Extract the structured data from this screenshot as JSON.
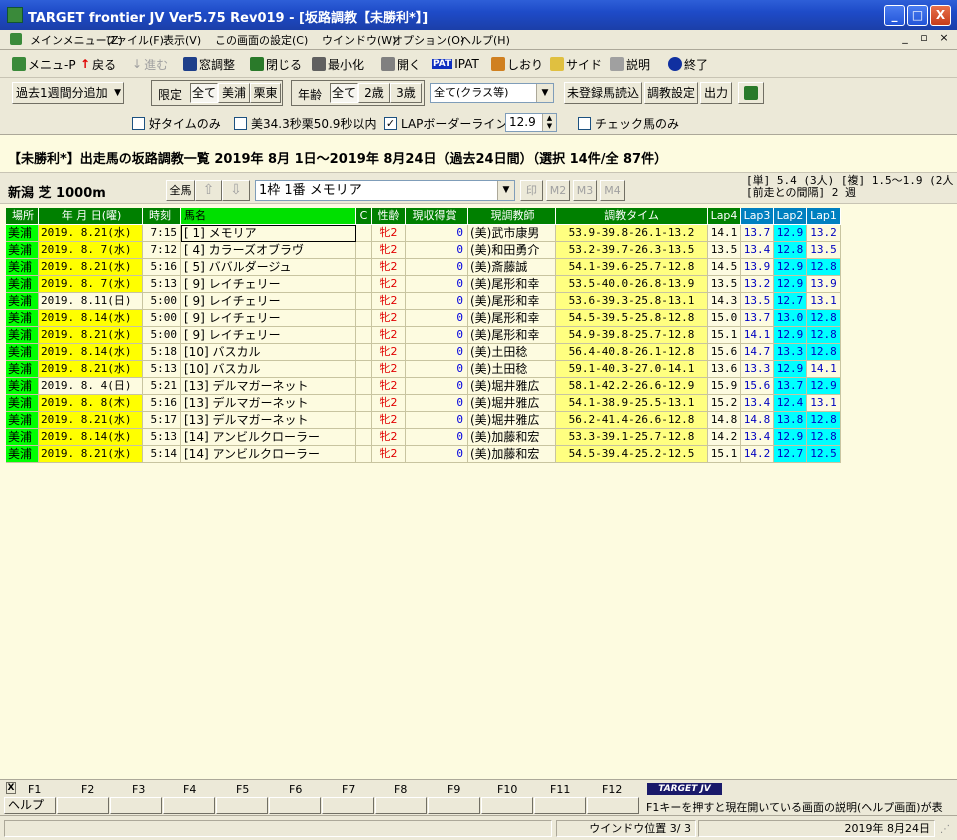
{
  "window": {
    "title": "TARGET frontier JV  Ver5.75  Rev019 - [坂路調教【未勝利*】]",
    "min": "_",
    "max": "□",
    "close": "X"
  },
  "menu": {
    "items": [
      "メインメニュー(Z)",
      "ファイル(F)",
      "表示(V)",
      "この画面の設定(C)",
      "ウインドウ(W)",
      "オプション(O)",
      "ヘルプ(H)"
    ],
    "mdi": [
      "_",
      "▫",
      "×"
    ]
  },
  "toolbar": {
    "items": [
      "メニュ-P",
      "戻る",
      "進む",
      "窓調整",
      "閉じる",
      "最小化",
      "開く",
      "IPAT",
      "しおり",
      "サイド",
      "説明",
      "終了"
    ],
    "pat_badge": "PAT"
  },
  "controls": {
    "period_btn": "過去1週間分追加",
    "period_arrow": "▼",
    "limit_label": "限定",
    "limit_opts": [
      "全て",
      "美浦",
      "栗東"
    ],
    "age_label": "年齢",
    "age_opts": [
      "全て",
      "2歳",
      "3歳"
    ],
    "class_select": "全て(クラス等)",
    "btn_unreg": "未登録馬読込",
    "btn_setting": "調教設定",
    "btn_output": "出力"
  },
  "checks": {
    "good_time": "好タイムのみ",
    "mi_cond": "美34.3秒栗50.9秒以内",
    "lap_border": "LAPボーダーライン",
    "lap_value": "12.9",
    "check_only": "チェック馬のみ",
    "checked_mark": "✓"
  },
  "heading": "【未勝利*】出走馬の坂路調教一覧  2019年 8月 1日～2019年 8月24日（過去24日間）（選択 14件/全 87件）",
  "race": {
    "name": "新潟 芝 1000m",
    "all_horses": "全馬",
    "up": "⇧",
    "down": "⇩",
    "horse_select": "1枠  1番  メモリア",
    "btn_mark": "印",
    "btn_m2": "M2",
    "btn_m3": "M3",
    "btn_m4": "M4",
    "odds_line1": "[単]   5.4 (3人) [複] 1.5～1.9 (2人",
    "odds_line2": "[前走との間隔] 2 週"
  },
  "table": {
    "headers": [
      "場所",
      "年  月 日(曜)",
      "時刻",
      "馬名",
      "C",
      "性齢",
      "現収得賞",
      "現調教師",
      "調教タイム",
      "Lap4",
      "Lap3",
      "Lap2",
      "Lap1"
    ],
    "rows": [
      {
        "place": "美浦",
        "date": "2019. 8.21(水)",
        "time": "7:15",
        "horse": "[ 1]  メモリア",
        "sex": "牝2",
        "prize": "0",
        "trainer": "(美)武市康男",
        "train": "53.9-39.8-26.1-13.2",
        "l4": "14.1",
        "l3": "13.7",
        "l2": "12.9",
        "l1": "13.2",
        "yel": true,
        "hl1": false
      },
      {
        "place": "美浦",
        "date": "2019. 8. 7(水)",
        "time": "7:12",
        "horse": "[ 4]  カラーズオブラヴ",
        "sex": "牝2",
        "prize": "0",
        "trainer": "(美)和田勇介",
        "train": "53.2-39.7-26.3-13.5",
        "l4": "13.5",
        "l3": "13.4",
        "l2": "12.8",
        "l1": "13.5",
        "yel": true,
        "hl1": false
      },
      {
        "place": "美浦",
        "date": "2019. 8.21(水)",
        "time": "5:16",
        "horse": "[ 5]  ババルダージュ",
        "sex": "牝2",
        "prize": "0",
        "trainer": "(美)斎藤誠",
        "train": "54.1-39.6-25.7-12.8",
        "l4": "14.5",
        "l3": "13.9",
        "l2": "12.9",
        "l1": "12.8",
        "yel": true,
        "hl1": true
      },
      {
        "place": "美浦",
        "date": "2019. 8. 7(水)",
        "time": "5:13",
        "horse": "[ 9]  レイチェリー",
        "sex": "牝2",
        "prize": "0",
        "trainer": "(美)尾形和幸",
        "train": "53.5-40.0-26.8-13.9",
        "l4": "13.5",
        "l3": "13.2",
        "l2": "12.9",
        "l1": "13.9",
        "yel": true,
        "hl1": false
      },
      {
        "place": "美浦",
        "date": "2019. 8.11(日)",
        "time": "5:00",
        "horse": "[ 9]  レイチェリー",
        "sex": "牝2",
        "prize": "0",
        "trainer": "(美)尾形和幸",
        "train": "53.6-39.3-25.8-13.1",
        "l4": "14.3",
        "l3": "13.5",
        "l2": "12.7",
        "l1": "13.1",
        "yel": false,
        "hl1": false
      },
      {
        "place": "美浦",
        "date": "2019. 8.14(水)",
        "time": "5:00",
        "horse": "[ 9]  レイチェリー",
        "sex": "牝2",
        "prize": "0",
        "trainer": "(美)尾形和幸",
        "train": "54.5-39.5-25.8-12.8",
        "l4": "15.0",
        "l3": "13.7",
        "l2": "13.0",
        "l1": "12.8",
        "yel": true,
        "hl1": true
      },
      {
        "place": "美浦",
        "date": "2019. 8.21(水)",
        "time": "5:00",
        "horse": "[ 9]  レイチェリー",
        "sex": "牝2",
        "prize": "0",
        "trainer": "(美)尾形和幸",
        "train": "54.9-39.8-25.7-12.8",
        "l4": "15.1",
        "l3": "14.1",
        "l2": "12.9",
        "l1": "12.8",
        "yel": true,
        "hl1": true
      },
      {
        "place": "美浦",
        "date": "2019. 8.14(水)",
        "time": "5:18",
        "horse": "[10]  バスカル",
        "sex": "牝2",
        "prize": "0",
        "trainer": "(美)土田稔",
        "train": "56.4-40.8-26.1-12.8",
        "l4": "15.6",
        "l3": "14.7",
        "l2": "13.3",
        "l1": "12.8",
        "yel": true,
        "hl1": true
      },
      {
        "place": "美浦",
        "date": "2019. 8.21(水)",
        "time": "5:13",
        "horse": "[10]  バスカル",
        "sex": "牝2",
        "prize": "0",
        "trainer": "(美)土田稔",
        "train": "59.1-40.3-27.0-14.1",
        "l4": "13.6",
        "l3": "13.3",
        "l2": "12.9",
        "l1": "14.1",
        "yel": true,
        "hl1": false
      },
      {
        "place": "美浦",
        "date": "2019. 8. 4(日)",
        "time": "5:21",
        "horse": "[13]  デルマガーネット",
        "sex": "牝2",
        "prize": "0",
        "trainer": "(美)堀井雅広",
        "train": "58.1-42.2-26.6-12.9",
        "l4": "15.9",
        "l3": "15.6",
        "l2": "13.7",
        "l1": "12.9",
        "yel": false,
        "hl1": true
      },
      {
        "place": "美浦",
        "date": "2019. 8. 8(木)",
        "time": "5:16",
        "horse": "[13]  デルマガーネット",
        "sex": "牝2",
        "prize": "0",
        "trainer": "(美)堀井雅広",
        "train": "54.1-38.9-25.5-13.1",
        "l4": "15.2",
        "l3": "13.4",
        "l2": "12.4",
        "l1": "13.1",
        "yel": true,
        "hl1": false
      },
      {
        "place": "美浦",
        "date": "2019. 8.21(水)",
        "time": "5:17",
        "horse": "[13]  デルマガーネット",
        "sex": "牝2",
        "prize": "0",
        "trainer": "(美)堀井雅広",
        "train": "56.2-41.4-26.6-12.8",
        "l4": "14.8",
        "l3": "14.8",
        "l2": "13.8",
        "l1": "12.8",
        "yel": true,
        "hl1": true
      },
      {
        "place": "美浦",
        "date": "2019. 8.14(水)",
        "time": "5:13",
        "horse": "[14]  アンビルクローラー",
        "sex": "牝2",
        "prize": "0",
        "trainer": "(美)加藤和宏",
        "train": "53.3-39.1-25.7-12.8",
        "l4": "14.2",
        "l3": "13.4",
        "l2": "12.9",
        "l1": "12.8",
        "yel": true,
        "hl1": true
      },
      {
        "place": "美浦",
        "date": "2019. 8.21(水)",
        "time": "5:14",
        "horse": "[14]  アンビルクローラー",
        "sex": "牝2",
        "prize": "0",
        "trainer": "(美)加藤和宏",
        "train": "54.5-39.4-25.2-12.5",
        "l4": "15.1",
        "l3": "14.2",
        "l2": "12.7",
        "l1": "12.5",
        "yel": true,
        "hl1": true
      }
    ]
  },
  "fkeys": {
    "x_mark": "X",
    "labels": [
      "F1",
      "F2",
      "F3",
      "F4",
      "F5",
      "F6",
      "F7",
      "F8",
      "F9",
      "F10",
      "F11",
      "F12"
    ],
    "brand": "TARGET JV",
    "f1_label": "ヘルプ",
    "help_text": "F1キーを押すと現在開いている画面の説明(ヘルプ画面)が表"
  },
  "status": {
    "window_pos": "ウインドウ位置 3/ 3",
    "date": "2019年 8月24日"
  }
}
